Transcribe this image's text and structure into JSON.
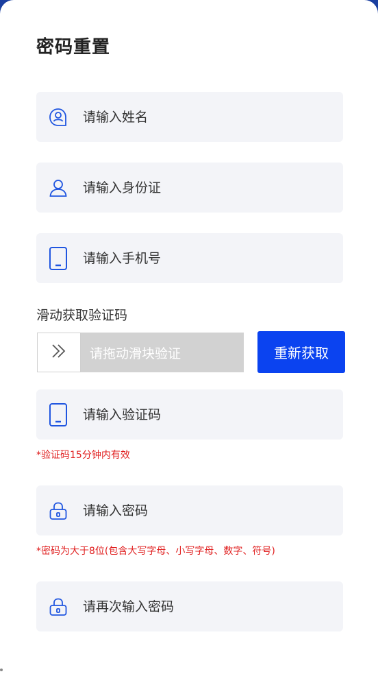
{
  "title": "密码重置",
  "fields": {
    "name": {
      "placeholder": "请输入姓名",
      "icon": "user-chat-icon"
    },
    "id_card": {
      "placeholder": "请输入身份证",
      "icon": "person-icon"
    },
    "phone": {
      "placeholder": "请输入手机号",
      "icon": "phone-icon"
    },
    "code": {
      "placeholder": "请输入验证码",
      "icon": "phone-icon"
    },
    "password": {
      "placeholder": "请输入密码",
      "icon": "lock-icon"
    },
    "password_confirm": {
      "placeholder": "请再次输入密码",
      "icon": "lock-icon"
    }
  },
  "captcha": {
    "label": "滑动获取验证码",
    "slider_text": "请拖动滑块验证",
    "refresh_label": "重新获取"
  },
  "hints": {
    "code": "*验证码15分钟内有效",
    "password": "*密码为大于8位(包含大写字母、小写字母、数字、符号)"
  },
  "colors": {
    "accent": "#0b43f0",
    "icon": "#1f55e0",
    "field_bg": "#f3f4f8",
    "hint": "#e02020"
  }
}
